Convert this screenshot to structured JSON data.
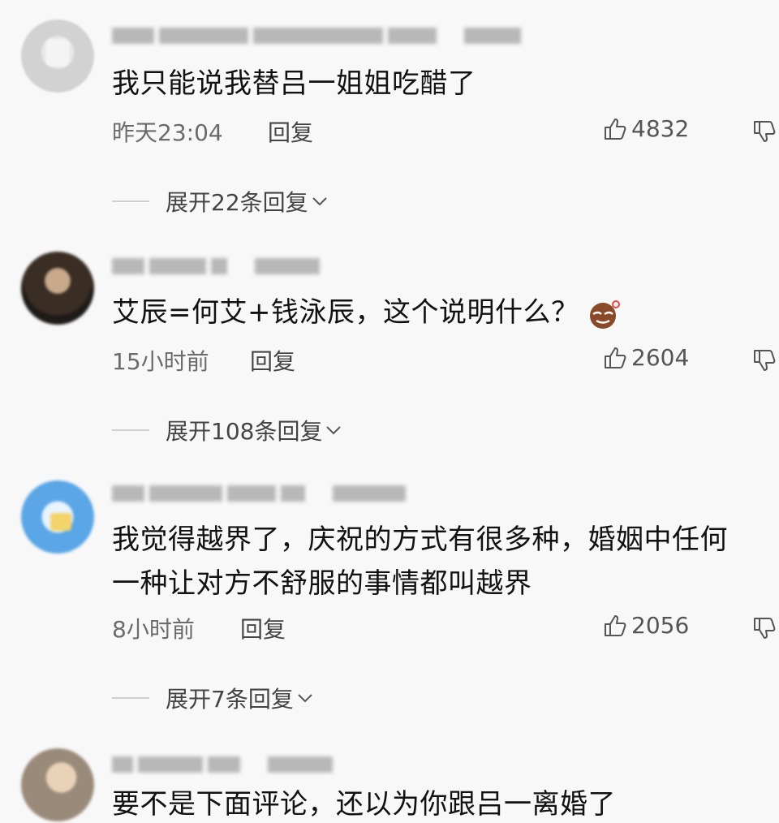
{
  "comments": [
    {
      "text": "我只能说我替吕一姐姐吃醋了",
      "time": "昨天23:04",
      "reply_label": "回复",
      "likes": "4832",
      "expand": "展开22条回复"
    },
    {
      "text": "艾辰=何艾+钱泳辰，这个说明什么？",
      "emoji": "sly-face-emoji",
      "time": "15小时前",
      "reply_label": "回复",
      "likes": "2604",
      "expand": "展开108条回复"
    },
    {
      "text_line1": "我觉得越界了，庆祝的方式有很多种，婚姻中任何",
      "text_line2": "一种让对方不舒服的事情都叫越界",
      "time": "8小时前",
      "reply_label": "回复",
      "likes": "2056",
      "expand": "展开7条回复"
    },
    {
      "text": "要不是下面评论，还以为你跟吕一离婚了"
    }
  ],
  "icons": {
    "like": "thumbs-up-icon",
    "dislike": "thumbs-down-icon",
    "expand": "chevron-down-icon"
  }
}
